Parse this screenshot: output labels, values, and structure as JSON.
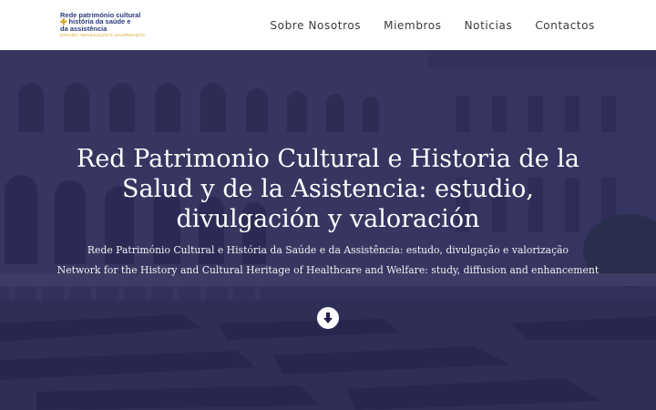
{
  "logo": {
    "line1": "Rede património cultural",
    "line2": "história da saúde e",
    "line3": "da assistência",
    "tagline": "ESTUDO, DIVULGAÇÃO E VALORIZAÇÃO",
    "cross_icon": "cross-icon"
  },
  "nav": {
    "items": [
      {
        "label": "Sobre Nosotros"
      },
      {
        "label": "Miembros"
      },
      {
        "label": "Noticias"
      },
      {
        "label": "Contactos"
      }
    ]
  },
  "hero": {
    "title": "Red Patrimonio Cultural e Historia de la Salud y de la Asistencia: estudio, divulgación y valoración",
    "subtitle_pt": "Rede Património Cultural e História da Saúde e da Assistência: estudo, divulgação e valorização",
    "subtitle_en": "Network for the History and Cultural Heritage of Healthcare and Welfare: study, diffusion and enhancement",
    "scroll_icon": "arrow-down-circle-icon"
  },
  "colors": {
    "logo_text": "#2b3a7a",
    "logo_accent": "#d9a21c",
    "nav_text": "#3a3a3a",
    "hero_overlay": "#23214e"
  }
}
